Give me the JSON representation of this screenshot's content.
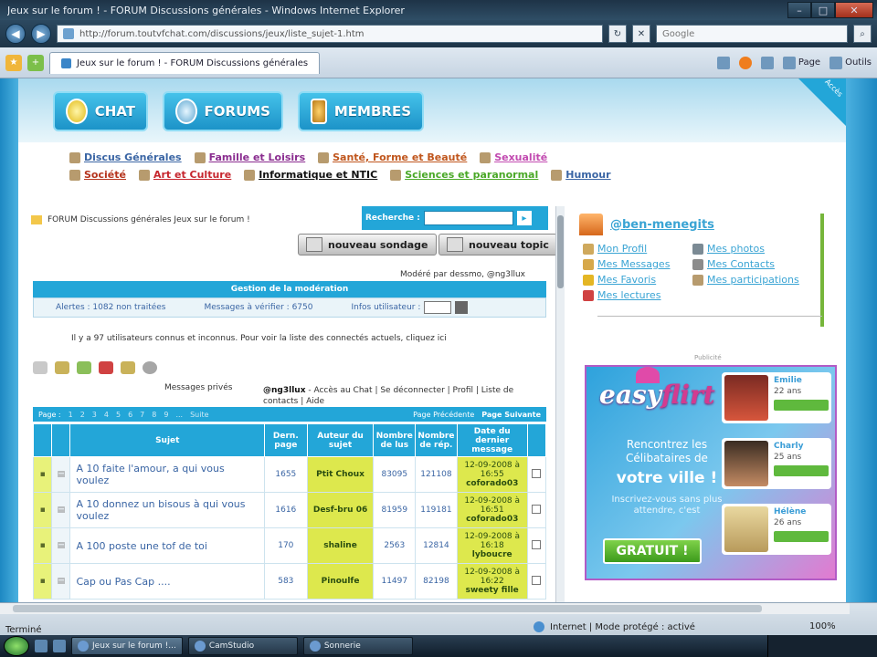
{
  "window": {
    "title": "Jeux sur le forum ! - FORUM Discussions générales - Windows Internet Explorer",
    "url": "http://forum.toutvfchat.com/discussions/jeux/liste_sujet-1.htm",
    "search_placeholder": "Google",
    "tab_label": "Jeux sur le forum ! - FORUM Discussions générales",
    "tools": {
      "page": "Page",
      "outils": "Outils"
    }
  },
  "nav": {
    "chat": "CHAT",
    "forums": "FORUMS",
    "membres": "MEMBRES",
    "corner_text": "Accès"
  },
  "categories": {
    "row1": [
      "Discus Générales",
      "Famille et Loisirs",
      "Santé, Forme et Beauté",
      "Sexualité"
    ],
    "row2": [
      "Société",
      "Art et Culture",
      "Informatique et NTIC",
      "Sciences et paranormal",
      "Humour"
    ]
  },
  "main": {
    "breadcrumb": "FORUM Discussions générales   Jeux sur le forum !",
    "search_label": "Recherche :",
    "btn_sondage": "nouveau sondage",
    "btn_topic": "nouveau topic",
    "moderated": "Modéré par dessmo, @ng3llux",
    "mod_bar": "Gestion de la modération",
    "alerts": "Alertes : 1082 non traitées",
    "messages_verify": "Messages à vérifier : 6750",
    "infos_user": "Infos utilisateur :",
    "online": "Il y a 97 utilisateurs connus et inconnus. Pour voir la liste des connectés actuels, cliquez ici",
    "private_messages": "Messages privés",
    "user": "@ng3llux",
    "user_links": "- Accès au Chat | Se déconnecter | Profil | Liste de contacts | Aide",
    "pager_label": "Page :",
    "pager_pages": [
      "1",
      "2",
      "3",
      "4",
      "5",
      "6",
      "7",
      "8",
      "9",
      "...",
      "Suite"
    ],
    "pager_prev": "Page Précédente",
    "pager_next": "Page Suivante"
  },
  "table": {
    "headers": [
      "Sujet",
      "Dern. page",
      "Auteur du sujet",
      "Nombre de lus",
      "Nombre de rép.",
      "Date du dernier message"
    ],
    "rows": [
      {
        "subject": "A 10 faite l'amour, a qui vous voulez",
        "page": "1655",
        "author": "Ptit Choux",
        "reads": "83095",
        "replies": "121108",
        "date": "12-09-2008 à 16:55",
        "last_by": "coforado03"
      },
      {
        "subject": "A 10 donnez un bisous à qui vous voulez",
        "page": "1616",
        "author": "Desf-bru 06",
        "reads": "81959",
        "replies": "119181",
        "date": "12-09-2008 à 16:51",
        "last_by": "coforado03"
      },
      {
        "subject": "A 100 poste une tof de toi",
        "page": "170",
        "author": "shaline",
        "reads": "2563",
        "replies": "12814",
        "date": "12-09-2008 à 16:18",
        "last_by": "lyboucre"
      },
      {
        "subject": "Cap ou Pas Cap ....",
        "page": "583",
        "author": "Pinoulfe",
        "reads": "11497",
        "replies": "82198",
        "date": "12-09-2008 à 16:22",
        "last_by": "sweety fille"
      }
    ]
  },
  "right": {
    "title": "@ben-menegits",
    "links": [
      "Mon Profil",
      "Mes photos",
      "Mes Messages",
      "Mes Contacts",
      "Mes Favoris",
      "Mes participations",
      "Mes lectures"
    ]
  },
  "ad": {
    "label": "Publicité",
    "brand_left": "easy",
    "brand_right": "flirt",
    "line1": "Rencontrez les Célibataires de",
    "line2": "votre ville !",
    "line3": "Inscrivez-vous sans plus attendre, c'est",
    "cta": "GRATUIT !",
    "profiles": [
      {
        "name": "Emilie",
        "age": "22 ans"
      },
      {
        "name": "Charly",
        "age": "25 ans"
      },
      {
        "name": "Hélène",
        "age": "26 ans"
      }
    ]
  },
  "status": {
    "left": "Terminé",
    "zone": "Internet | Mode protégé : activé",
    "zoom": "100%"
  },
  "taskbar": {
    "items": [
      "Jeux sur le forum !...",
      "CamStudio",
      "Sonnerie"
    ]
  },
  "colors": {
    "accent": "#23a6d8",
    "highlight": "#dde84d",
    "link": "#3a65a4"
  }
}
